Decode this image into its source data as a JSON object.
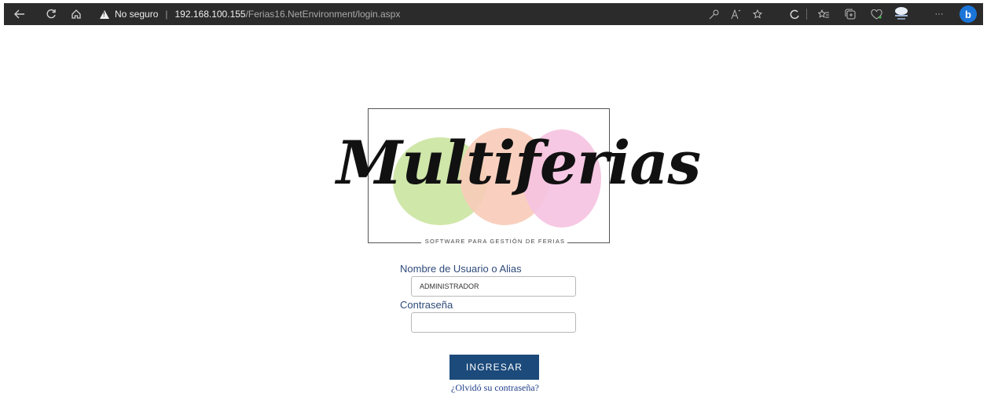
{
  "browser": {
    "security_text": "No seguro",
    "url_host": "192.168.100.155",
    "url_path": "/Ferias16.NetEnvironment/login.aspx",
    "more_label": "···",
    "bing_letter": "b",
    "bing_color": "#1b75d8"
  },
  "logo": {
    "wordmark": "Multiferias",
    "tagline": "SOFTWARE PARA GESTIÓN DE FERIAS",
    "blob_colors": [
      "#c7e39a",
      "#f8cbb8",
      "#f5c2e0"
    ]
  },
  "form": {
    "username_label": "Nombre de Usuario o Alias",
    "username_value": "ADMINISTRADOR",
    "password_label": "Contraseña",
    "password_value": "",
    "submit_label": "INGRESAR",
    "forgot_label": "¿Olvidó su contraseña?",
    "accent_color": "#1b4a7b"
  }
}
